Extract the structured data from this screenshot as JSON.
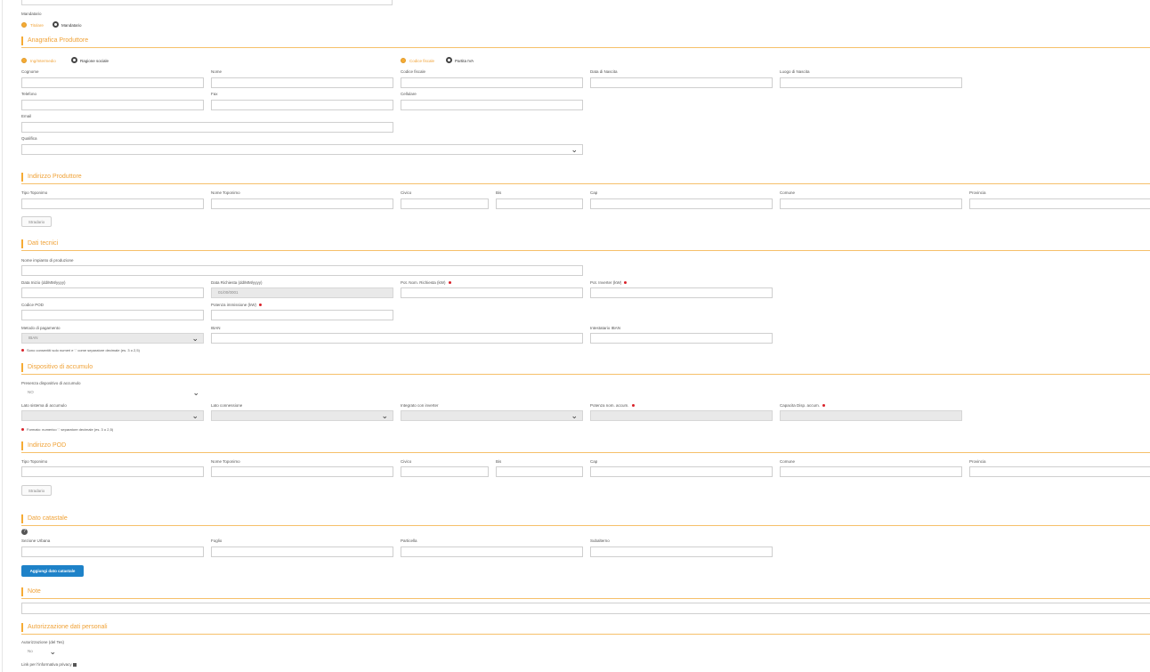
{
  "top": {
    "mandatario_label": "Mandatario",
    "radio_titolare": "Titolare",
    "radio_mandatario": "Mandatario"
  },
  "anagrafica": {
    "title": "Anagrafica Produttore",
    "radio_persona": "Ing/Intermedio",
    "radio_ragione": "Ragione sociale",
    "radio_cf": "Codice fiscale",
    "radio_piva": "Partita IVA",
    "cognome": "Cognome",
    "nome": "Nome",
    "codice_fiscale": "Codice fiscale",
    "data_nascita": "Data di Nascita",
    "luogo_nascita": "Luogo di Nascita",
    "telefono": "Telefono",
    "fax": "Fax",
    "cellulare": "Cellulare",
    "email": "Email",
    "qualifica": "Qualifica"
  },
  "indirizzo_produttore": {
    "title": "Indirizzo Produttore",
    "tipo_toponimo": "Tipo Toponimo",
    "nome_toponimo": "Nome Toponimo",
    "civico": "Civico",
    "bis": "Bis",
    "cap": "Cap",
    "comune": "Comune",
    "provincia": "Provincia",
    "button": "Stradario"
  },
  "dati_tecnici": {
    "title": "Dati tecnici",
    "nome_impianto": "Nome impianto di produzione",
    "data_inizio": "Data Inizio (dd/MM/yyyy)",
    "data_richiesta": "Data Richiesta (dd/MM/yyyy)",
    "data_richiesta_value": "01/00/0001",
    "pot_nom": "Pot. Nom. Richiesta (kW)",
    "pot_inverter": "Pot. Inverter (kW)",
    "codice_pod": "Codice POD",
    "potenza_immissione": "Potenza immissione (kW)",
    "metodo_pagamento": "Metodo di pagamento",
    "metodo_value": "IBAN",
    "iban": "IBAN",
    "intestatario": "Intestatario IBAN",
    "note": "Sono consentiti solo numeri e '.' come separatore decimale (es. 3 o 2,5)"
  },
  "accumulo": {
    "title": "Dispositivo di accumulo",
    "presenza": "Presenza dispositivo di accumulo",
    "presenza_value": "NO",
    "lato_sistema": "Lato sistema di accumulo",
    "lato_connessione": "Lato connessione",
    "integrato": "Integrato con inverter",
    "potenza_nom": "Potenza nom. accum.",
    "capacita": "Capacita Disp. accum.",
    "note": "Formato: numerico '.' separatore decimale (es. 3 o 2,5)"
  },
  "indirizzo_pod": {
    "title": "Indirizzo POD",
    "tipo_toponimo": "Tipo Toponimo",
    "nome_toponimo": "Nome Toponimo",
    "civico": "Civico",
    "bis": "Bis",
    "cap": "Cap",
    "comune": "Comune",
    "provincia": "Provincia",
    "button": "Stradario"
  },
  "catastale": {
    "title": "Dato catastale",
    "sezione": "Sezione Urbana",
    "foglio": "Foglio",
    "particella": "Particella",
    "subalterno": "Subalterno",
    "button": "Aggiungi dato catastale"
  },
  "note_section": {
    "title": "Note"
  },
  "privacy": {
    "title": "Autorizzazione dati personali",
    "autorizzazione": "Autorizzazione (del Tes)",
    "autorizzazione_value": "No",
    "link": "Link per l'informativa privacy"
  }
}
